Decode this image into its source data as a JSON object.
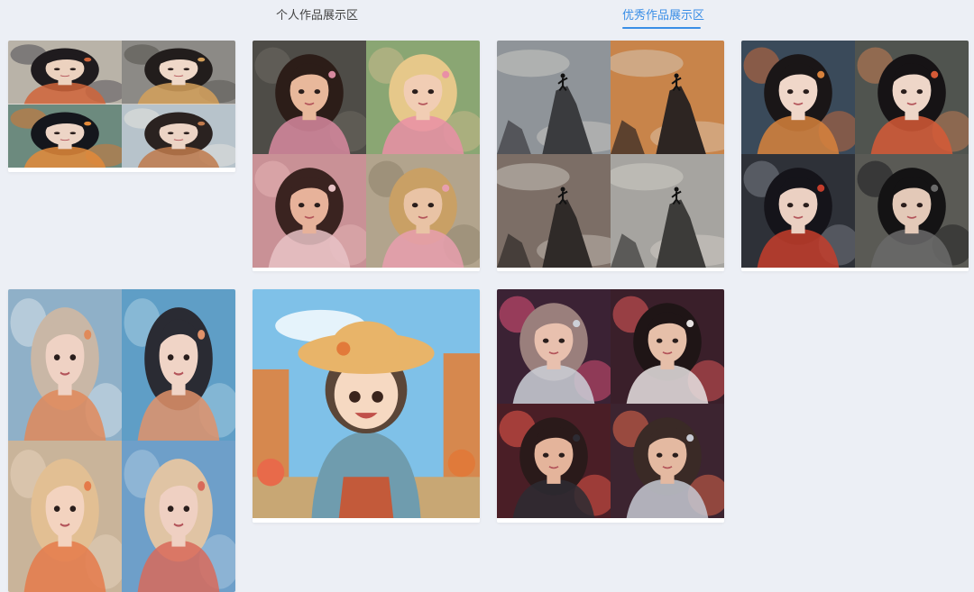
{
  "tabs": {
    "personal_label": "个人作品展示区",
    "featured_label": "优秀作品展示区",
    "active": "featured"
  },
  "colors": {
    "accent": "#3a8ee6",
    "background": "#eceff5"
  },
  "gallery": [
    {
      "name": "gallery-card-hanfu-garden",
      "subject": "hanfu-girl-garden",
      "images": [
        {
          "bg": "#b9b3a8",
          "sub": "#4d4a52",
          "skin": "#ecd2bf",
          "hair": "#1f1b1e",
          "acc": "#d0643a"
        },
        {
          "bg": "#8c8a86",
          "sub": "#54524d",
          "skin": "#efd8c8",
          "hair": "#221d1c",
          "acc": "#d4a05a"
        },
        {
          "bg": "#6c8a7e",
          "sub": "#d9762f",
          "skin": "#edd5c6",
          "hair": "#14161c",
          "acc": "#e38a3a"
        },
        {
          "bg": "#b7c3cb",
          "sub": "#e6e4df",
          "skin": "#ecd4c5",
          "hair": "#2a2220",
          "acc": "#c07a4c"
        }
      ]
    },
    {
      "name": "gallery-card-cartoon-girls",
      "subject": "3d-cartoon-girl",
      "images": [
        {
          "bg": "#4e4c47",
          "sub": "#6d6a62",
          "skin": "#e8b89b",
          "hair": "#2c1d18",
          "acc": "#d88aa0"
        },
        {
          "bg": "#8aa673",
          "sub": "#c9b88a",
          "skin": "#f1cdb4",
          "hair": "#e6c88a",
          "acc": "#e98fa6"
        },
        {
          "bg": "#c99196",
          "sub": "#e4b3b4",
          "skin": "#e7b29a",
          "hair": "#3a2320",
          "acc": "#e8c2c5"
        },
        {
          "bg": "#b2a48d",
          "sub": "#8e826c",
          "skin": "#e9c3a5",
          "hair": "#c9a065",
          "acc": "#e79fae"
        }
      ]
    },
    {
      "name": "gallery-card-cliff-climbers",
      "subject": "cliff-climber",
      "images": [
        {
          "bg": "#8f9499",
          "sub": "#3a3b3e",
          "acc": "#111111"
        },
        {
          "bg": "#c8844a",
          "sub": "#2d2522",
          "acc": "#111111"
        },
        {
          "bg": "#7c6e66",
          "sub": "#2f2a28",
          "acc": "#111111"
        },
        {
          "bg": "#a6a4a0",
          "sub": "#3c3b39",
          "acc": "#111111"
        }
      ]
    },
    {
      "name": "gallery-card-chinese-opera",
      "subject": "ornate-portrait",
      "images": [
        {
          "bg": "#3a4a5a",
          "sub": "#c96a3a",
          "skin": "#f0d7c9",
          "hair": "#1a1617",
          "acc": "#d8823c"
        },
        {
          "bg": "#50544f",
          "sub": "#c77b52",
          "skin": "#eed6c8",
          "hair": "#161315",
          "acc": "#d65a36"
        },
        {
          "bg": "#2e3138",
          "sub": "#7a7e86",
          "skin": "#ebd0c2",
          "hair": "#15141a",
          "acc": "#c43d2c"
        },
        {
          "bg": "#5a5a55",
          "sub": "#1e1e20",
          "skin": "#e3c9b8",
          "hair": "#141314",
          "acc": "#6a6a6a"
        }
      ]
    },
    {
      "name": "gallery-card-water-girls",
      "subject": "girl-in-water",
      "images": [
        {
          "bg": "#8fb0c8",
          "sub": "#d7e2ea",
          "skin": "#efd2c4",
          "hair": "#c9b7a6",
          "acc": "#e08a5a"
        },
        {
          "bg": "#5f9ec6",
          "sub": "#a8cde2",
          "skin": "#f0d4c6",
          "hair": "#2a2b33",
          "acc": "#e0926a"
        },
        {
          "bg": "#c9b49a",
          "sub": "#e6d2bc",
          "skin": "#f3d3bf",
          "hair": "#e2bf93",
          "acc": "#e57a4a"
        },
        {
          "bg": "#6e9fc9",
          "sub": "#a9c7df",
          "skin": "#efd0c2",
          "hair": "#e0c4a4",
          "acc": "#d86a5a"
        }
      ]
    },
    {
      "name": "gallery-card-sunhat-girl",
      "subject": "anime-sunhat-girl",
      "single": true,
      "images": [
        {
          "bg": "#7fc1e8",
          "sub": "#d6884e",
          "skin": "#f6d9c2",
          "hair": "#5b4638",
          "acc": "#e8b469"
        }
      ]
    },
    {
      "name": "gallery-card-neon-city",
      "subject": "neon-city-portrait",
      "images": [
        {
          "bg": "#3b2234",
          "sub": "#e4527a",
          "skin": "#e8c0ae",
          "hair": "#9a7f7c",
          "acc": "#cdd0d8"
        },
        {
          "bg": "#3a1f2a",
          "sub": "#e65a5a",
          "skin": "#e6bfa9",
          "hair": "#1f1516",
          "acc": "#e7e2e2"
        },
        {
          "bg": "#4a1e26",
          "sub": "#ef5a4a",
          "skin": "#e4b49b",
          "hair": "#2a1a1a",
          "acc": "#2d2b33"
        },
        {
          "bg": "#3c2430",
          "sub": "#e56a4c",
          "skin": "#e4b9a1",
          "hair": "#3a2a26",
          "acc": "#c6c9d2"
        }
      ]
    }
  ]
}
